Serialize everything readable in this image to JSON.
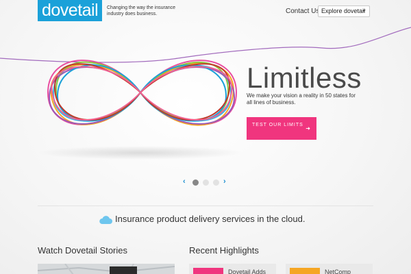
{
  "header": {
    "logo_text": "dovetail",
    "tagline": "Changing the way the insurance industry does business.",
    "contact_label": "Contact Us",
    "explore_label": "Explore dovetail"
  },
  "hero": {
    "title": "Limitless",
    "subtitle": "We make your vision a reality in 50 states for all lines of business.",
    "button_label": "TEST OUR LIMITS",
    "slides": 3,
    "active_slide": 1
  },
  "cloud_banner": {
    "text": "Insurance product delivery services in the cloud."
  },
  "sections": {
    "stories_title": "Watch Dovetail Stories",
    "highlights_title": "Recent Highlights",
    "highlights": [
      {
        "label": "Dovetail Adds",
        "color": "#f0357e"
      },
      {
        "label": "NetComp",
        "color": "#f5a623"
      }
    ]
  },
  "colors": {
    "brand_blue": "#1ba1d9",
    "accent_pink": "#f0357e",
    "accent_orange": "#f5a623"
  }
}
